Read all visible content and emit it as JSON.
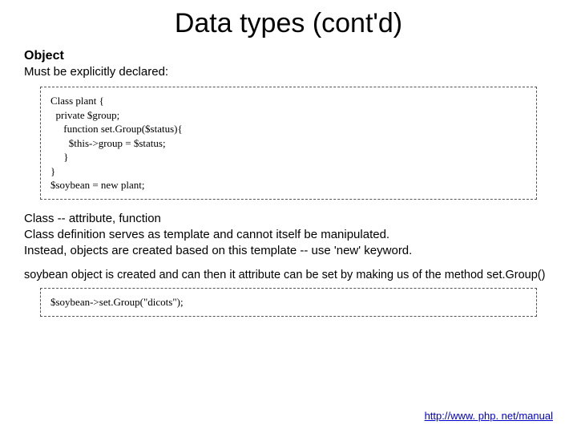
{
  "title": "Data types (cont'd)",
  "heading": "Object",
  "subheading": "Must be explicitly declared:",
  "code1": {
    "l1": "Class plant {",
    "l2": "  private $group;",
    "l3": "     function set.Group($status){",
    "l4": "       $this->group = $status;",
    "l5": "     }",
    "l6": "}",
    "l7": "$soybean = new plant;"
  },
  "para1": {
    "l1": "Class -- attribute, function",
    "l2": "Class definition serves as template and cannot itself be manipulated.",
    "l3": "Instead, objects are created based on this template -- use 'new' keyword."
  },
  "para2": "soybean object is created and can then it attribute can be set by making us of the method set.Group()",
  "code2": {
    "l1": "$soybean->set.Group(\"dicots\");"
  },
  "footer": {
    "label": "http://www. php. net/manual",
    "href": "http://www.php.net/manual"
  }
}
